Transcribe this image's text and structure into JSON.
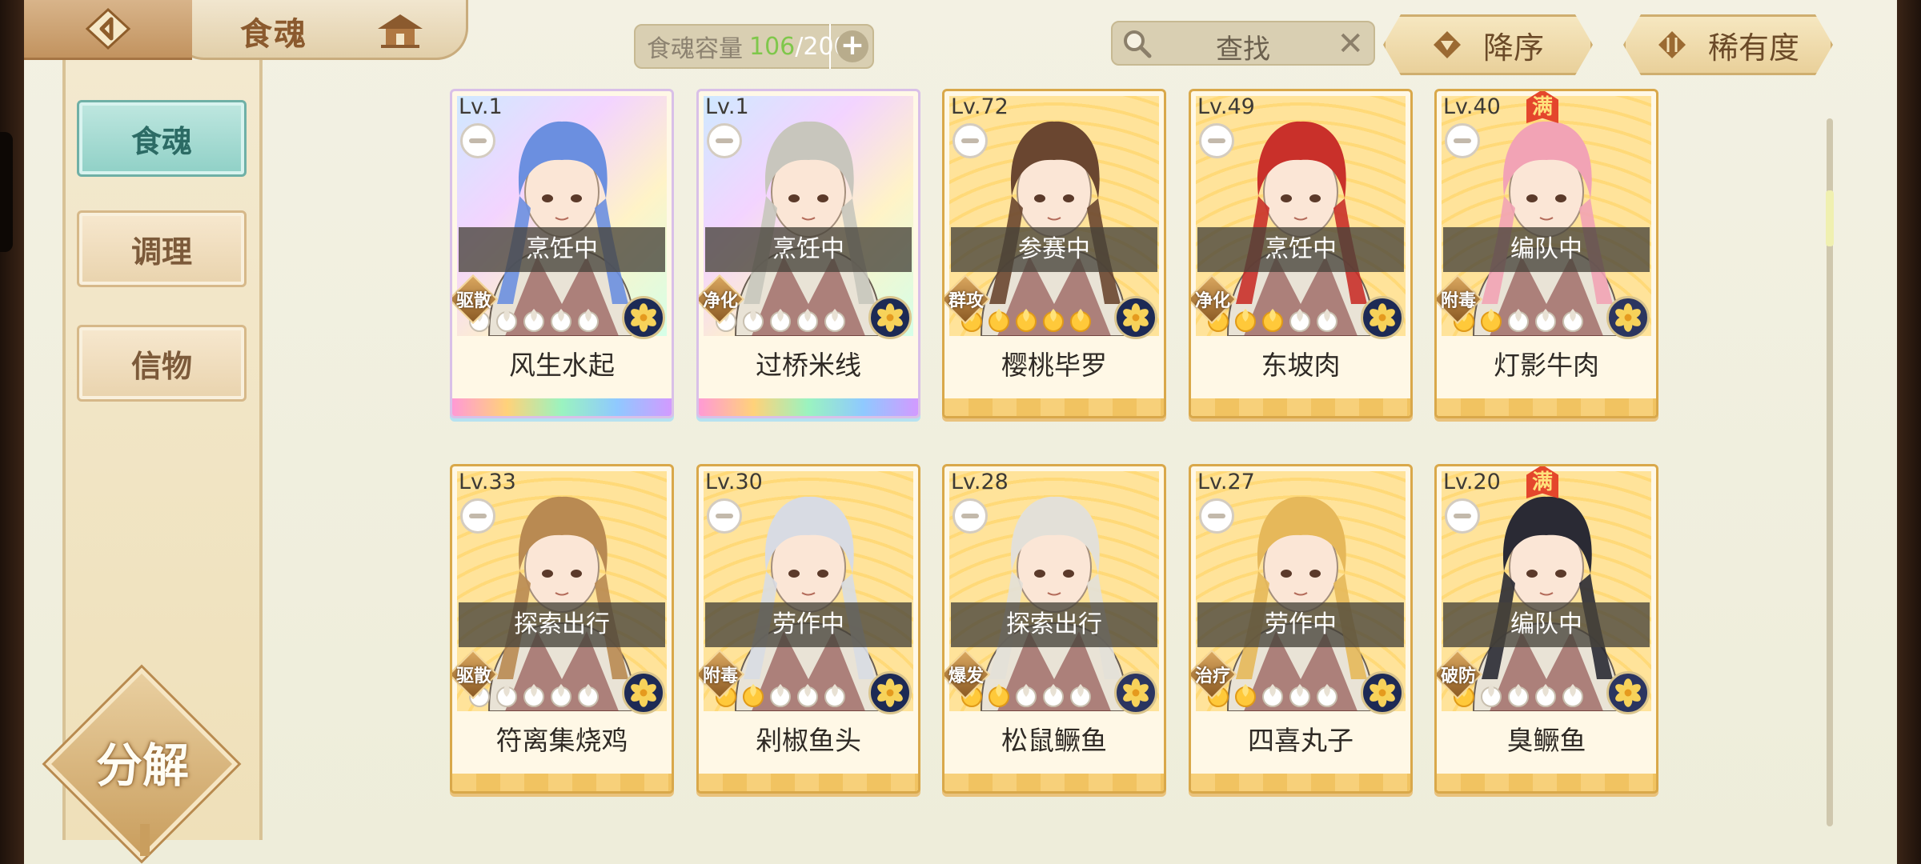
{
  "header": {
    "title": "食魂",
    "capacity": {
      "label": "食魂容量",
      "current": "106",
      "separator": "/",
      "max": "200"
    },
    "search": {
      "placeholder": "查找"
    },
    "sort_desc_label": "降序",
    "sort_rarity_label": "稀有度"
  },
  "sidebar": {
    "items": [
      {
        "label": "食魂",
        "active": true
      },
      {
        "label": "调理",
        "active": false
      },
      {
        "label": "信物",
        "active": false
      }
    ],
    "decompose_label": "分解"
  },
  "cards": [
    {
      "level": "Lv.1",
      "status": "烹饪中",
      "role": "驱散",
      "name": "风生水起",
      "stars": 0,
      "full": false,
      "rarity": "rainbow",
      "hair": "#6b8fe0",
      "element": "#1d2a55"
    },
    {
      "level": "Lv.1",
      "status": "烹饪中",
      "role": "净化",
      "name": "过桥米线",
      "stars": 0,
      "full": false,
      "rarity": "rainbow",
      "hair": "#c8c6bd",
      "element": "#1d2a55"
    },
    {
      "level": "Lv.72",
      "status": "参赛中",
      "role": "群攻",
      "name": "樱桃毕罗",
      "stars": 5,
      "full": false,
      "rarity": "gold",
      "hair": "#6a4630",
      "element": "#1d2a55"
    },
    {
      "level": "Lv.49",
      "status": "烹饪中",
      "role": "净化",
      "name": "东坡肉",
      "stars": 3,
      "full": false,
      "rarity": "gold",
      "hair": "#c9302a",
      "element": "#1d2a55"
    },
    {
      "level": "Lv.40",
      "status": "编队中",
      "role": "附毒",
      "name": "灯影牛肉",
      "stars": 2,
      "full": true,
      "rarity": "gold",
      "hair": "#f2a3b5",
      "element": "#2b3560"
    },
    {
      "level": "Lv.33",
      "status": "探索出行",
      "role": "驱散",
      "name": "符离集烧鸡",
      "stars": 0,
      "full": false,
      "rarity": "gold",
      "hair": "#b98a52",
      "element": "#1d2a55"
    },
    {
      "level": "Lv.30",
      "status": "劳作中",
      "role": "附毒",
      "name": "剁椒鱼头",
      "stars": 2,
      "full": false,
      "rarity": "gold",
      "hair": "#d8dbe3",
      "element": "#1d2a55"
    },
    {
      "level": "Lv.28",
      "status": "探索出行",
      "role": "爆发",
      "name": "松鼠鳜鱼",
      "stars": 2,
      "full": false,
      "rarity": "gold",
      "hair": "#e3e0d8",
      "element": "#2b3560"
    },
    {
      "level": "Lv.27",
      "status": "劳作中",
      "role": "治疗",
      "name": "四喜丸子",
      "stars": 2,
      "full": false,
      "rarity": "gold",
      "hair": "#e6b85a",
      "element": "#1d2a55"
    },
    {
      "level": "Lv.20",
      "status": "编队中",
      "role": "破防",
      "name": "臭鳜鱼",
      "stars": 1,
      "full": true,
      "rarity": "gold",
      "hair": "#2a2a34",
      "element": "#2b3560"
    }
  ]
}
